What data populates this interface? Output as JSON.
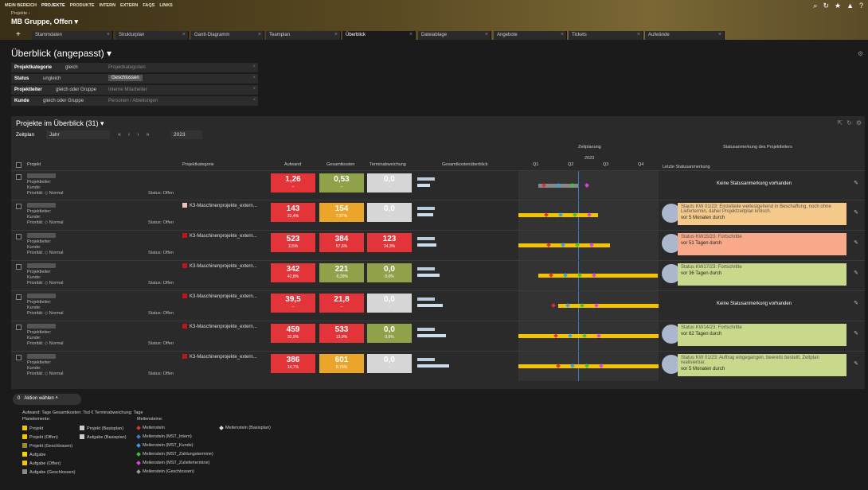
{
  "nav": {
    "items": [
      "MEIN BEREICH",
      "PROJEKTE",
      "PRODUKTE",
      "INTERN",
      "EXTERN",
      "FAQS",
      "LINKS"
    ]
  },
  "breadcrumb": "Projekte ›",
  "project_name": "MB Gruppe, Offen ▾",
  "tabs": [
    "Stammdaten",
    "Strukturplan",
    "Gantt-Diagramm",
    "Teamplan",
    "Überblick",
    "Dateiablage",
    "Angebote",
    "Tickets",
    "Aufwände"
  ],
  "page_title": "Überblick (angepasst) ▾",
  "filters": [
    {
      "label": "Projektkategorie",
      "op": "gleich",
      "value": "Projektkategorien"
    },
    {
      "label": "Status",
      "op": "ungleich",
      "value": "Geschlossen"
    },
    {
      "label": "Projektleiter",
      "op": "gleich oder Gruppe",
      "value": "Interne Mitarbeiter"
    },
    {
      "label": "Kunde",
      "op": "gleich oder Gruppe",
      "value": "Personen / Abteilungen"
    }
  ],
  "panel_title": "Projekte im Überblick (31) ▾",
  "zeitplan_label": "Zeitplan",
  "zeitplan_value": "Jahr",
  "year": "2023",
  "columns": {
    "projekt": "Projekt",
    "kategorie": "Projektkategorie",
    "aufwand": "Aufwand",
    "gesamtkosten": "Gesamtkosten",
    "termin": "Terminabweichung",
    "ueberblick": "Gesamtkostenüberblick",
    "zeitplanung": "Zeitplanung",
    "year": "2023",
    "q": [
      "Q1",
      "Q2",
      "Q3",
      "Q4"
    ],
    "statushead": "Statusanmerkung des Projektleiters",
    "letzte": "Letzte Statusanmerkung"
  },
  "rowlabels": {
    "leiter": "Projektleiter:",
    "kunde": "Kunde:",
    "prio": "Priorität:",
    "prio_val": "Normal",
    "status": "Status:",
    "status_val": "Offen"
  },
  "rows": [
    {
      "cat": "",
      "a": "1,26",
      "ap": "–",
      "g": "0,53",
      "gp": "–",
      "t": "0,0",
      "tp": "–",
      "ac": "red",
      "gc": "green",
      "tc": "grey",
      "note": "",
      "nc": "",
      "nd": "",
      "none": "Keine Statusanmerkung vorhanden"
    },
    {
      "cat": "K3-Maschinenprojekte_extern...",
      "a": "143",
      "ap": "22,4%",
      "g": "154",
      "gp": "7,97%",
      "t": "0,0",
      "tp": "–",
      "ac": "red",
      "gc": "orange",
      "tc": "grey",
      "note": "Stauts KW 01/23: Einzelteile weitestgehend in Beschaffung, noch ohne Liefertermin, daher Projektzeitplan kritisch.",
      "nc": "#f5c98a",
      "nd": "vor 5 Monaten durch",
      "none": ""
    },
    {
      "cat": "K3-Maschinenprojekte_extern...",
      "a": "523",
      "ap": "115%",
      "g": "384",
      "gp": "57,6%",
      "t": "123",
      "tp": "34,3%",
      "ac": "red",
      "gc": "red",
      "tc": "red",
      "note": "Status KW15/23: Fortschritte",
      "nc": "#f7a98a",
      "nd": "vor 51 Tagen durch",
      "none": ""
    },
    {
      "cat": "K3-Maschinenprojekte_extern...",
      "a": "342",
      "ap": "42,8%",
      "g": "221",
      "gp": "-6,39%",
      "t": "0,0",
      "tp": "0,0%",
      "ac": "red",
      "gc": "green",
      "tc": "green",
      "note": "Status KW17/23: Fortschritte",
      "nc": "#c8d98c",
      "nd": "vor 36 Tagen durch",
      "none": ""
    },
    {
      "cat": "K3-Maschinenprojekte_extern...",
      "a": "39,5",
      "ap": "–",
      "g": "21,8",
      "gp": "–",
      "t": "0,0",
      "tp": "–",
      "ac": "red",
      "gc": "red",
      "tc": "grey",
      "note": "",
      "nc": "",
      "nd": "",
      "none": "Keine Statusanmerkung vorhanden"
    },
    {
      "cat": "K3-Maschinenprojekte_extern...",
      "a": "459",
      "ap": "32,9%",
      "g": "533",
      "gp": "13,9%",
      "t": "0,0",
      "tp": "0,0%",
      "ac": "red",
      "gc": "red",
      "tc": "green",
      "note": "Status KW14/23: Fortschritte",
      "nc": "#c8d98c",
      "nd": "vor 62 Tagen durch",
      "none": ""
    },
    {
      "cat": "K3-Maschinenprojekte_extern...",
      "a": "386",
      "ap": "14,7%",
      "g": "601",
      "gp": "8,76%",
      "t": "0,0",
      "tp": "–",
      "ac": "red",
      "gc": "orange",
      "tc": "grey",
      "note": "Status KW 01/23: Auftrag eingegangen, beereits bestellt, Zeitplan realisierbar.",
      "nc": "#c8d98c",
      "nd": "vor 5 Monaten durch",
      "none": ""
    }
  ],
  "action": "Aktion wählen",
  "action_count": "0",
  "legend": {
    "units": "Aufwand: Tage  Gesamtkosten: Tsd €  Terminabweichung: Tage",
    "planelemente": "Planelemente:",
    "meilensteine": "Meilensteine:",
    "col1": [
      "Projekt",
      "Projekt (Offen)",
      "Projekt (Geschlossen)",
      "Aufgabe",
      "Aufgabe (Offen)",
      "Aufgabe (Geschlossen)"
    ],
    "col2": [
      "Projekt (Basisplan)",
      "Aufgabe (Basisplan)"
    ],
    "col3": [
      "Meilenstein",
      "Meilenstein (MST_Intern)",
      "Meilenstein (MST_Kunde)",
      "Meilenstein (MST_Zahlungstermine)",
      "Meilenstein (MST_Zuliefertermine)",
      "Meilenstein (Geschlossen)"
    ],
    "col4": [
      "Meilenstein (Basisplan)"
    ]
  }
}
